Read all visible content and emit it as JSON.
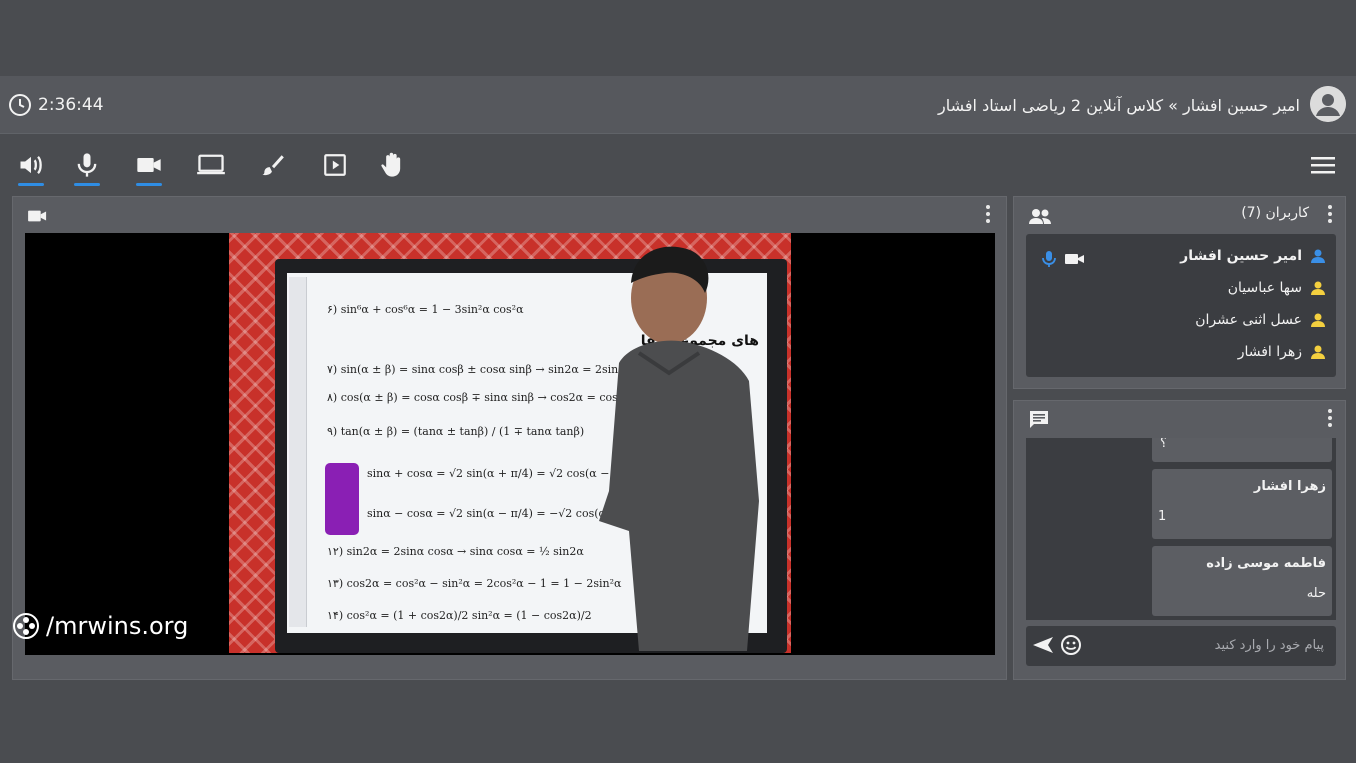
{
  "header": {
    "time": "2:36:44",
    "breadcrumb": "امیر حسین افشار » کلاس آنلاین 2 ریاضی استاد افشار"
  },
  "toolbar": {
    "items": [
      {
        "name": "speaker-icon",
        "active": true
      },
      {
        "name": "microphone-icon",
        "active": true
      },
      {
        "name": "camera-icon",
        "active": true
      },
      {
        "name": "screen-share-icon",
        "active": false
      },
      {
        "name": "brush-icon",
        "active": false
      },
      {
        "name": "play-icon",
        "active": false
      },
      {
        "name": "raise-hand-icon",
        "active": false
      }
    ]
  },
  "video": {
    "watermark": "/mrwins.org",
    "board": {
      "heading": "های مجموع و تفا",
      "equations": [
        "۶) sin⁶α + cos⁶α = 1 − 3sin²α cos²α",
        "۷) sin(α ± β) = sinα cosβ ± cosα sinβ → sin2α = 2sinα cosα",
        "۸) cos(α ± β) = cosα cosβ ∓ sinα sinβ → cos2α = cos²α − sin²α",
        "۹) tan(α ± β) = (tanα ± tanβ) / (1 ∓ tanα tanβ)",
        "sinα + cosα = √2 sin(α + π/4) = √2 cos(α − π/4)",
        "sinα − cosα = √2 sin(α − π/4) = −√2 cos(α + π/4)",
        "۱۲) sin2α = 2sinα cosα → sinα cosα = ½ sin2α",
        "۱۳) cos2α = cos²α − sin²α = 2cos²α − 1 = 1 − 2sin²α",
        "۱۴) cos²α = (1 + cos2α)/2     sin²α = (1 − cos2α)/2"
      ]
    }
  },
  "users": {
    "title": "کاربران (7)",
    "list": [
      {
        "name": "امیر حسین افشار",
        "me": true,
        "color": "#3a8fe6"
      },
      {
        "name": "سها عباسیان",
        "me": false,
        "color": "#f4d03f"
      },
      {
        "name": "عسل اثنی عشران",
        "me": false,
        "color": "#f4d03f"
      },
      {
        "name": "زهرا افشار",
        "me": false,
        "color": "#f4d03f"
      }
    ]
  },
  "chat": {
    "messages": [
      {
        "author": "",
        "body": "؟"
      },
      {
        "author": "زهرا افشار",
        "body": "1"
      },
      {
        "author": "فاطمه موسی زاده",
        "body": "حله"
      }
    ],
    "placeholder": "پیام خود را وارد کنید"
  },
  "colors": {
    "accent": "#2f8de4",
    "background": "#4a4c50",
    "panel": "#5a5c61",
    "inner": "#3b3d41"
  }
}
